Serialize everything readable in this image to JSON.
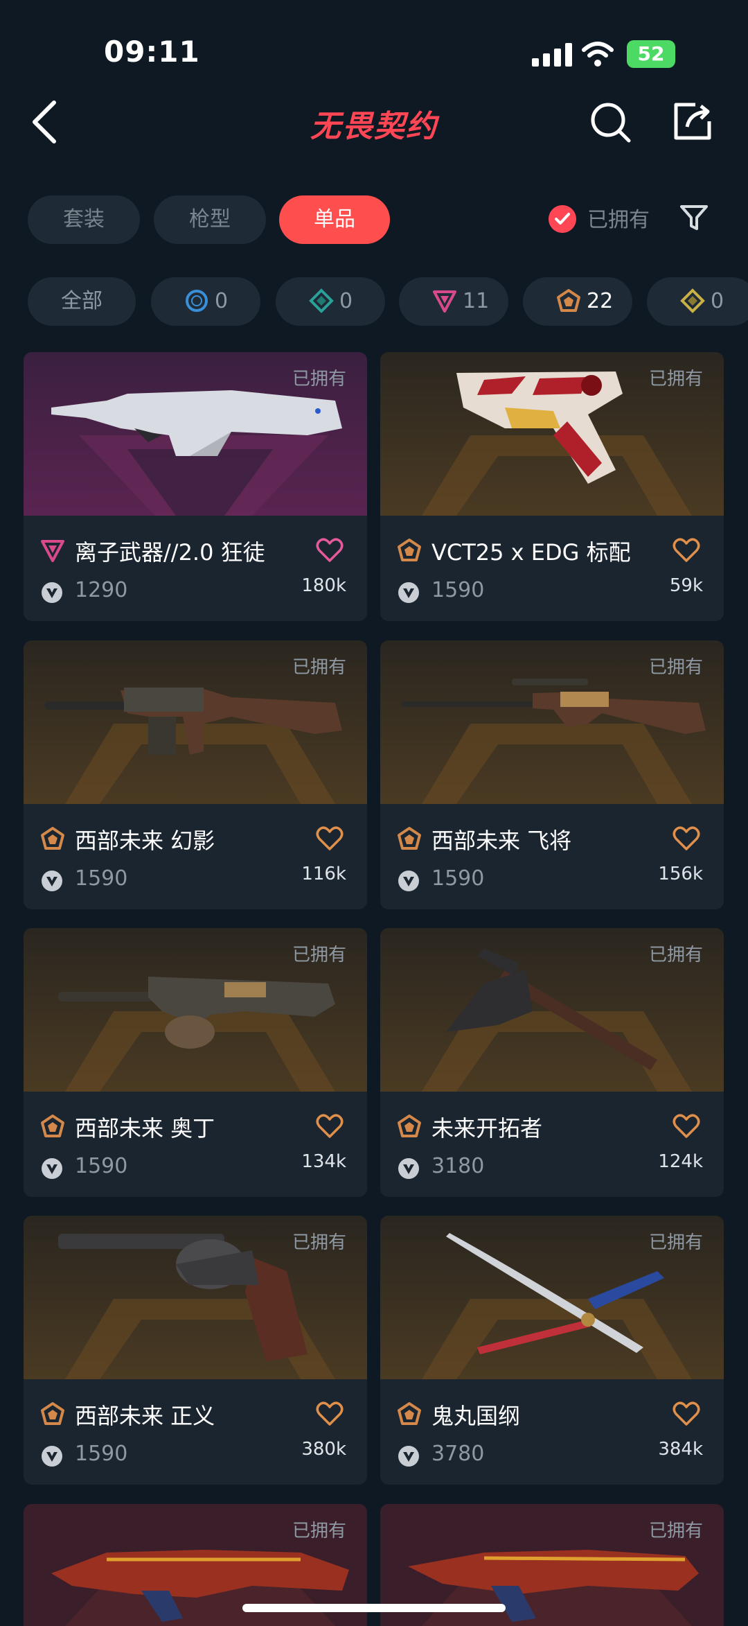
{
  "status": {
    "time": "09:11",
    "battery": "52"
  },
  "header": {
    "brand": "无畏契约"
  },
  "tabs": [
    {
      "label": "套装",
      "active": false
    },
    {
      "label": "枪型",
      "active": false
    },
    {
      "label": "单品",
      "active": true
    }
  ],
  "owned_filter": {
    "label": "已拥有",
    "checked": true
  },
  "tier_chips": [
    {
      "label": "全部"
    },
    {
      "icon": "select-tier-icon",
      "count": "0"
    },
    {
      "icon": "deluxe-tier-icon",
      "count": "0"
    },
    {
      "icon": "premium-tier-icon",
      "count": "11"
    },
    {
      "icon": "exclusive-tier-icon",
      "count": "22"
    },
    {
      "icon": "ultra-tier-icon",
      "count": "0"
    }
  ],
  "cards": [
    {
      "owned": "已拥有",
      "tier": "premium-tier-icon",
      "name": "离子武器//2.0 狂徒",
      "price": "1290",
      "likes": "180k"
    },
    {
      "owned": "已拥有",
      "tier": "exclusive-tier-icon",
      "name": "VCT25 x EDG 标配",
      "price": "1590",
      "likes": "59k"
    },
    {
      "owned": "已拥有",
      "tier": "exclusive-tier-icon",
      "name": "西部未来 幻影",
      "price": "1590",
      "likes": "116k"
    },
    {
      "owned": "已拥有",
      "tier": "exclusive-tier-icon",
      "name": "西部未来 飞将",
      "price": "1590",
      "likes": "156k"
    },
    {
      "owned": "已拥有",
      "tier": "exclusive-tier-icon",
      "name": "西部未来 奥丁",
      "price": "1590",
      "likes": "134k"
    },
    {
      "owned": "已拥有",
      "tier": "exclusive-tier-icon",
      "name": "未来开拓者",
      "price": "3180",
      "likes": "124k"
    },
    {
      "owned": "已拥有",
      "tier": "exclusive-tier-icon",
      "name": "西部未来 正义",
      "price": "1590",
      "likes": "380k"
    },
    {
      "owned": "已拥有",
      "tier": "exclusive-tier-icon",
      "name": "鬼丸国纲",
      "price": "3780",
      "likes": "384k"
    },
    {
      "owned": "已拥有"
    },
    {
      "owned": "已拥有"
    }
  ],
  "colors": {
    "accent": "#ff4e4e",
    "background": "#0f1923",
    "card": "#1a2530",
    "exclusive": "#d4894a",
    "premium": "#d94a8c"
  }
}
